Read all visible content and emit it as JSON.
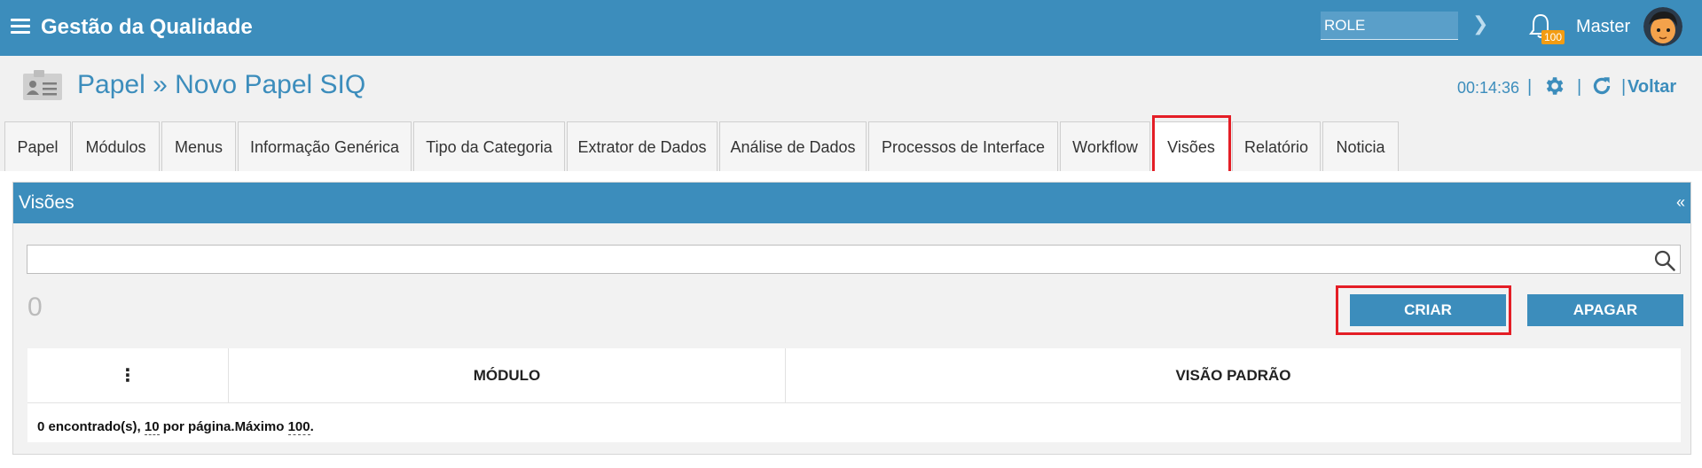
{
  "topbar": {
    "app_title": "Gestão da Qualidade",
    "role_value": "ROLE",
    "notification_count": "100",
    "user_name": "Master"
  },
  "header": {
    "title": "Papel » Novo Papel SIQ",
    "timer": "00:14:36",
    "back_label": "Voltar"
  },
  "tabs": [
    {
      "label": "Papel"
    },
    {
      "label": "Módulos"
    },
    {
      "label": "Menus"
    },
    {
      "label": "Informação Genérica"
    },
    {
      "label": "Tipo da Categoria"
    },
    {
      "label": "Extrator de Dados"
    },
    {
      "label": "Análise de Dados"
    },
    {
      "label": "Processos de Interface"
    },
    {
      "label": "Workflow"
    },
    {
      "label": "Visões",
      "active": true
    },
    {
      "label": "Relatório"
    },
    {
      "label": "Noticia"
    }
  ],
  "panel": {
    "title": "Visões",
    "collapse_symbol": "«",
    "search_value": "",
    "record_count": "0",
    "create_label": "CRIAR",
    "delete_label": "APAGAR",
    "table": {
      "menu_symbol": "⋮",
      "columns": [
        "MÓDULO",
        "VISÃO PADRÃO"
      ],
      "rows": []
    },
    "footer": {
      "found": "0 encontrado(s), ",
      "per_page_value": "10",
      "per_page_text": " por página.",
      "max_text": "Máximo ",
      "max_value": "100",
      "end": "."
    }
  },
  "colors": {
    "primary": "#3c8dbc",
    "badge": "#f39c12",
    "highlight": "#e41e26"
  }
}
